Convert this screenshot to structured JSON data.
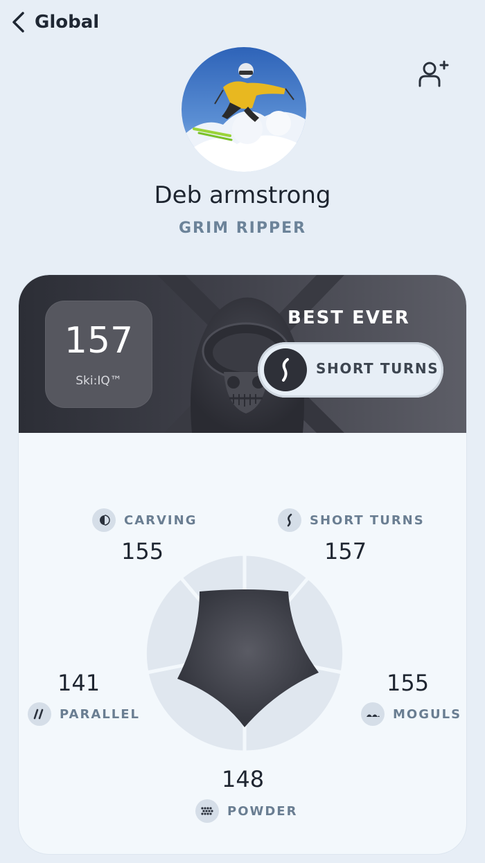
{
  "header": {
    "back_label": "Global"
  },
  "profile": {
    "name": "Deb armstrong",
    "rank": "GRIM RIPPER"
  },
  "score": {
    "value": "157",
    "label": "Ski:IQ™"
  },
  "best": {
    "heading": "BEST EVER",
    "discipline": "SHORT TURNS"
  },
  "stats": {
    "carving": {
      "label": "CARVING",
      "value": "155"
    },
    "short_turns": {
      "label": "SHORT TURNS",
      "value": "157"
    },
    "parallel": {
      "label": "PARALLEL",
      "value": "141"
    },
    "moguls": {
      "label": "MOGULS",
      "value": "155"
    },
    "powder": {
      "label": "POWDER",
      "value": "148"
    }
  },
  "colors": {
    "accent_dark": "#2e3038",
    "label_gray": "#6c8399",
    "background": "#e7eef6"
  }
}
